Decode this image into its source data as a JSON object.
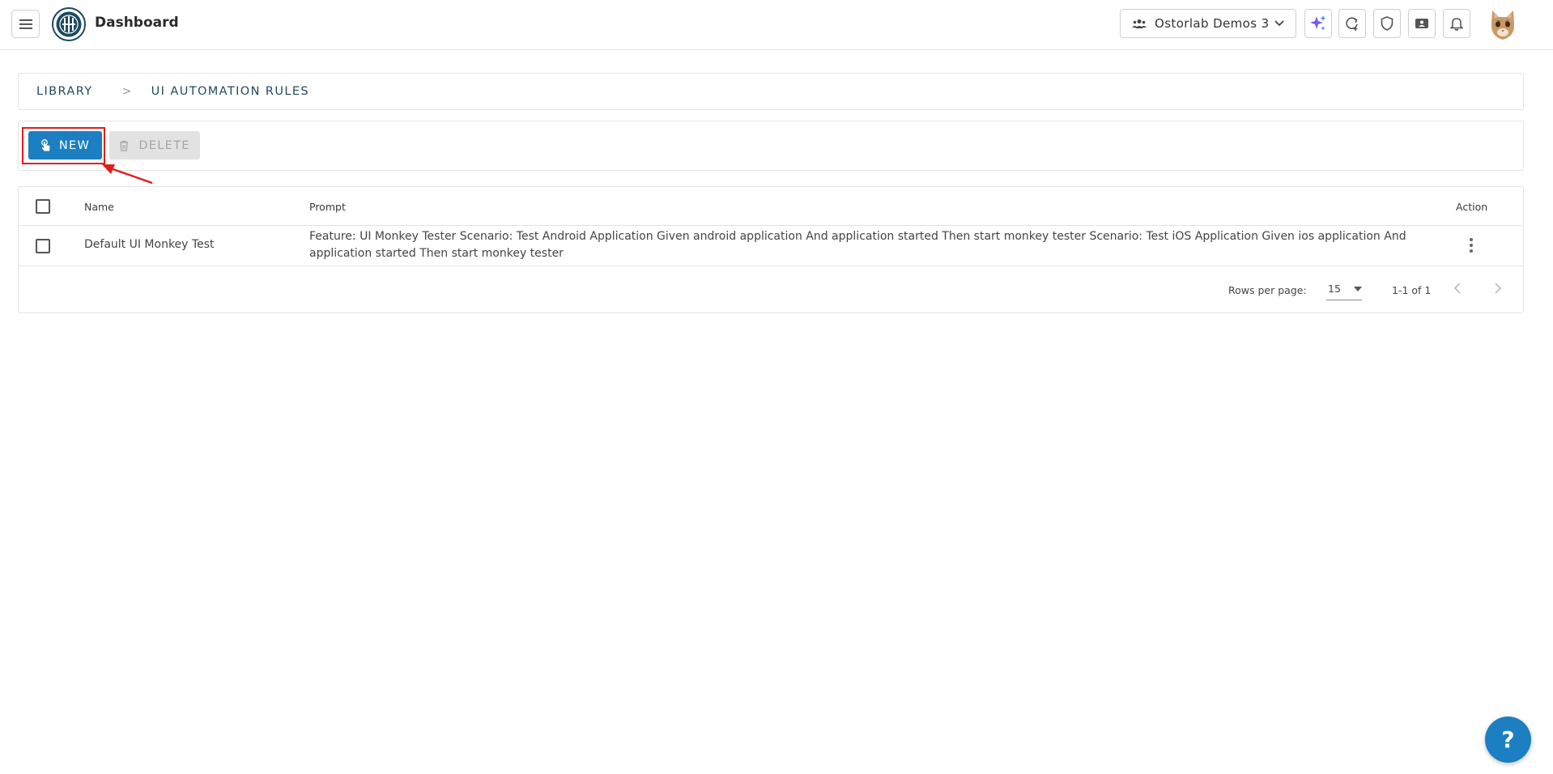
{
  "header": {
    "title": "Dashboard",
    "org_name": "Ostorlab Demos 3",
    "icons": [
      "menu-icon",
      "logo-icon",
      "team-icon",
      "chevron-down-icon",
      "sparkle-icon",
      "refresh-add-icon",
      "shield-icon",
      "ticket-icon",
      "bell-icon",
      "cat-avatar"
    ]
  },
  "breadcrumb": {
    "root": "LIBRARY",
    "separator": ">",
    "current": "UI AUTOMATION RULES"
  },
  "toolbar": {
    "new_label": "NEW",
    "delete_label": "DELETE"
  },
  "table": {
    "columns": {
      "name": "Name",
      "prompt": "Prompt",
      "action": "Action"
    },
    "rows": [
      {
        "name": "Default UI Monkey Test",
        "prompt": "Feature: UI Monkey Tester Scenario: Test Android Application Given android application And application started Then start monkey tester Scenario: Test iOS Application Given ios application And application started Then start monkey tester"
      }
    ],
    "footer": {
      "rows_per_page_label": "Rows per page:",
      "rows_per_page_value": "15",
      "range": "1-1 of 1"
    }
  },
  "help": {
    "label": "?"
  },
  "colors": {
    "primary": "#1b7fc1",
    "highlight": "#e11d1d",
    "ai_accent": "#7b5cf0"
  }
}
